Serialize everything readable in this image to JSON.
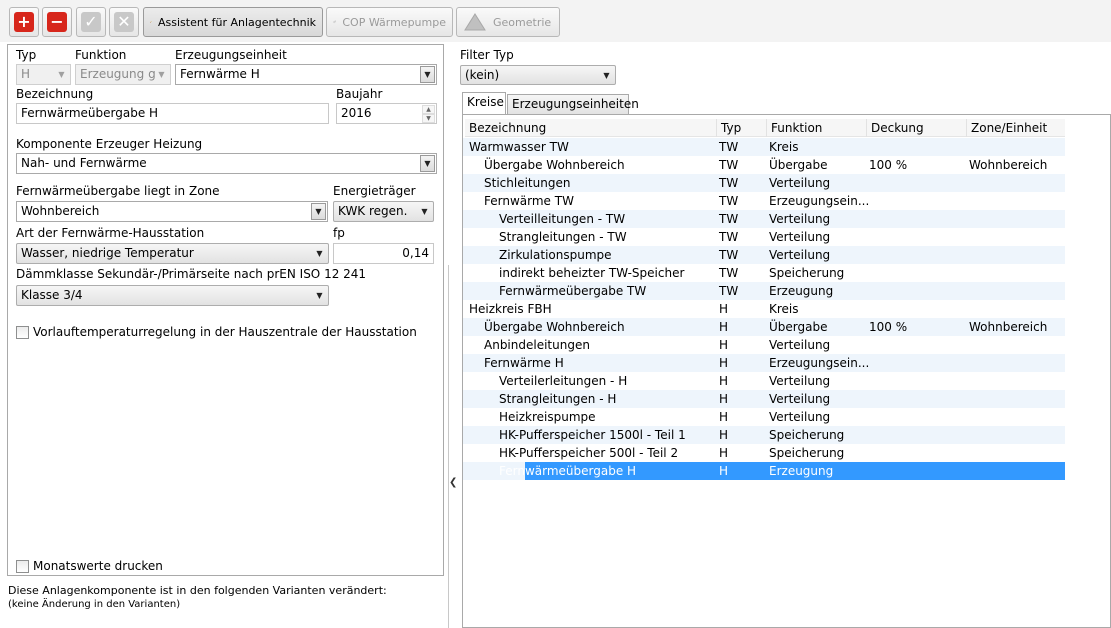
{
  "toolbar": {
    "add_label": "+",
    "remove_label": "−",
    "confirm_label": "✓",
    "cancel_label": "✕",
    "assistant_label": "Assistent für Anlagentechnik",
    "cop_label": "COP Wärmepumpe",
    "geometry_label": "Geometrie",
    "colors": {
      "add": "#d7261b",
      "remove": "#d7261b",
      "disabled": "#c8c8c8"
    }
  },
  "form": {
    "typ_label": "Typ",
    "typ_value": "H",
    "funktion_label": "Funktion",
    "funktion_value": "Erzeugung g",
    "erzeugungseinheit_label": "Erzeugungseinheit",
    "erzeugungseinheit_value": "Fernwärme H",
    "bezeichnung_label": "Bezeichnung",
    "bezeichnung_value": "Fernwärmeübergabe H",
    "baujahr_label": "Baujahr",
    "baujahr_value": "2016",
    "komponente_label": "Komponente Erzeuger Heizung",
    "komponente_value": "Nah- und Fernwärme",
    "zone_label": "Fernwärmeübergabe liegt in Zone",
    "zone_value": "Wohnbereich",
    "energietraeger_label": "Energieträger",
    "energietraeger_value": "KWK regen.",
    "hausstation_label": "Art der Fernwärme-Hausstation",
    "hausstation_value": "Wasser, niedrige Temperatur",
    "fp_label": "fp",
    "fp_value": "0,14",
    "daemmklasse_label": "Dämmklasse Sekundär-/Primärseite nach prEN ISO 12 241",
    "daemmklasse_value": "Klasse 3/4",
    "vorlauf_label": "Vorlauftemperaturregelung in der Hauszentrale der Hausstation",
    "monatswerte_label": "Monatswerte drucken"
  },
  "variants": {
    "line1": "Diese Anlagenkomponente ist in den folgenden Varianten verändert:",
    "line2": "(keine Änderung in den Varianten)"
  },
  "filter": {
    "label": "Filter Typ",
    "value": "(kein)"
  },
  "tabs": [
    {
      "label": "Kreise",
      "active": true
    },
    {
      "label": "Erzeugungseinheiten",
      "active": false
    }
  ],
  "tree": {
    "columns": [
      "Bezeichnung",
      "Typ",
      "Funktion",
      "Deckung",
      "Zone/Einheit"
    ],
    "rows": [
      {
        "name": "Warmwasser TW",
        "typ": "TW",
        "funktion": "Kreis",
        "deckung": "",
        "zone": "",
        "level": 0
      },
      {
        "name": "Übergabe Wohnbereich",
        "typ": "TW",
        "funktion": "Übergabe",
        "deckung": "100 %",
        "zone": "Wohnbereich",
        "level": 1
      },
      {
        "name": "Stichleitungen",
        "typ": "TW",
        "funktion": "Verteilung",
        "deckung": "",
        "zone": "",
        "level": 1
      },
      {
        "name": "Fernwärme TW",
        "typ": "TW",
        "funktion": "Erzeugungsein...",
        "deckung": "",
        "zone": "",
        "level": 1
      },
      {
        "name": "Verteilleitungen - TW",
        "typ": "TW",
        "funktion": "Verteilung",
        "deckung": "",
        "zone": "",
        "level": 2
      },
      {
        "name": "Strangleitungen - TW",
        "typ": "TW",
        "funktion": "Verteilung",
        "deckung": "",
        "zone": "",
        "level": 2
      },
      {
        "name": "Zirkulationspumpe",
        "typ": "TW",
        "funktion": "Verteilung",
        "deckung": "",
        "zone": "",
        "level": 2
      },
      {
        "name": "indirekt beheizter TW-Speicher",
        "typ": "TW",
        "funktion": "Speicherung",
        "deckung": "",
        "zone": "",
        "level": 2
      },
      {
        "name": "Fernwärmeübergabe TW",
        "typ": "TW",
        "funktion": "Erzeugung",
        "deckung": "",
        "zone": "",
        "level": 2
      },
      {
        "name": "Heizkreis FBH",
        "typ": "H",
        "funktion": "Kreis",
        "deckung": "",
        "zone": "",
        "level": 0
      },
      {
        "name": "Übergabe Wohnbereich",
        "typ": "H",
        "funktion": "Übergabe",
        "deckung": "100 %",
        "zone": "Wohnbereich",
        "level": 1
      },
      {
        "name": "Anbindeleitungen",
        "typ": "H",
        "funktion": "Verteilung",
        "deckung": "",
        "zone": "",
        "level": 1
      },
      {
        "name": "Fernwärme H",
        "typ": "H",
        "funktion": "Erzeugungsein...",
        "deckung": "",
        "zone": "",
        "level": 1
      },
      {
        "name": "Verteilerleitungen - H",
        "typ": "H",
        "funktion": "Verteilung",
        "deckung": "",
        "zone": "",
        "level": 2
      },
      {
        "name": "Strangleitungen - H",
        "typ": "H",
        "funktion": "Verteilung",
        "deckung": "",
        "zone": "",
        "level": 2
      },
      {
        "name": "Heizkreispumpe",
        "typ": "H",
        "funktion": "Verteilung",
        "deckung": "",
        "zone": "",
        "level": 2
      },
      {
        "name": "HK-Pufferspeicher 1500l - Teil 1",
        "typ": "H",
        "funktion": "Speicherung",
        "deckung": "",
        "zone": "",
        "level": 2
      },
      {
        "name": "HK-Pufferspeicher 500l - Teil 2",
        "typ": "H",
        "funktion": "Speicherung",
        "deckung": "",
        "zone": "",
        "level": 2
      },
      {
        "name": "Fernwärmeübergabe H",
        "typ": "H",
        "funktion": "Erzeugung",
        "deckung": "",
        "zone": "",
        "level": 2,
        "selected": true
      }
    ],
    "selection_color": "#3399ff"
  }
}
